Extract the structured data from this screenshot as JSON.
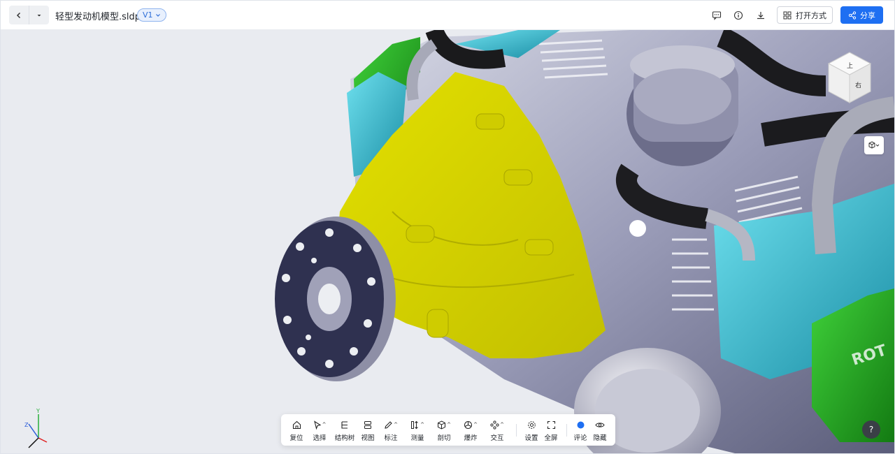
{
  "header": {
    "filename": "轻型发动机模型.sldprt",
    "version": "V1",
    "open_with_label": "打开方式",
    "share_label": "分享"
  },
  "icons": {
    "back": "chevron-left-icon",
    "history": "caret-down-icon",
    "comment": "comment-icon",
    "info": "info-icon",
    "download": "download-icon",
    "apps": "grid-icon",
    "share": "share-icon"
  },
  "viewcube": {
    "top_label": "上",
    "right_label": "右"
  },
  "axes": {
    "y": "Y",
    "z": "Z"
  },
  "toolbar": {
    "items": [
      {
        "label": "复位",
        "icon": "home-icon"
      },
      {
        "label": "选择",
        "icon": "cursor-icon"
      },
      {
        "label": "结构树",
        "icon": "tree-icon"
      },
      {
        "label": "视图",
        "icon": "view-icon"
      },
      {
        "label": "标注",
        "icon": "pen-icon"
      },
      {
        "label": "测量",
        "icon": "measure-icon"
      },
      {
        "label": "剖切",
        "icon": "section-cube-icon"
      },
      {
        "label": "爆炸",
        "icon": "explode-icon"
      },
      {
        "label": "交互",
        "icon": "interact-icon"
      },
      {
        "label": "设置",
        "icon": "gear-icon"
      },
      {
        "label": "全屏",
        "icon": "fullscreen-icon"
      },
      {
        "label": "评论",
        "icon": "comment-dot-icon"
      },
      {
        "label": "隐藏",
        "icon": "eye-icon"
      }
    ]
  },
  "help_label": "?",
  "colors": {
    "primary": "#1e6ff2",
    "highlight": "#d6d200",
    "canvas": "#e9ebf0"
  }
}
